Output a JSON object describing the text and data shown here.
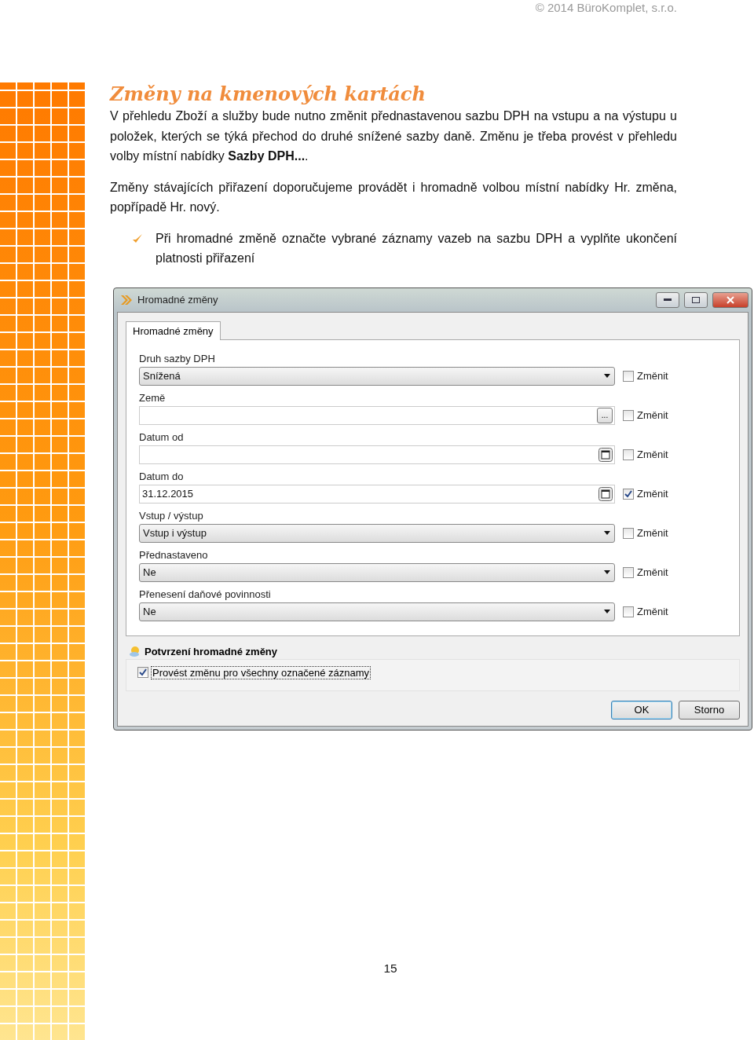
{
  "header": {
    "copyright": "© 2014 BüroKomplet, s.r.o."
  },
  "heading": "Změny na kmenových kartách",
  "paragraphs": [
    "V přehledu Zboží a služby bude nutno změnit přednastavenou sazbu DPH na vstupu a na výstupu u položek, kterých se týká přechod do druhé snížené sazby daně. Změnu je třeba provést v přehledu volby místní nabídky **Sazby DPH...**.",
    "Změny stávajících přiřazení doporučujeme provádět i hromadně volbou místní nabídky Hr. změna, popřípadě Hr. nový."
  ],
  "bullet": "Při hromadné změně označte vybrané záznamy vazeb na sazbu DPH a vyplňte ukončení platnosti přiřazení",
  "dialog": {
    "title": "Hromadné změny",
    "tabs": [
      {
        "label": "Hromadné změny",
        "selected": true
      }
    ],
    "fields": [
      {
        "label": "Druh sazby DPH",
        "kind": "select",
        "value": "Snížená",
        "checkbox_label": "Změnit",
        "checked": false
      },
      {
        "label": "Země",
        "kind": "lookup",
        "button": "...",
        "checkbox_label": "Změnit",
        "checked": false
      },
      {
        "label": "Datum od",
        "kind": "date",
        "checkbox_label": "Změnit",
        "checked": false
      },
      {
        "label": "Datum do",
        "kind": "date",
        "value": "31.12.2015",
        "checkbox_label": "Změnit",
        "checked": true
      },
      {
        "label": "Vstup / výstup",
        "kind": "select",
        "value": "Vstup i výstup",
        "checkbox_label": "Změnit",
        "checked": false
      },
      {
        "label": "Přednastaveno",
        "kind": "select",
        "value": "Ne",
        "checkbox_label": "Změnit",
        "checked": false
      },
      {
        "label": "Přenesení daňové povinnosti",
        "kind": "select",
        "value": "Ne",
        "checkbox_label": "Změnit",
        "checked": false
      }
    ],
    "confirm": {
      "title": "Potvrzení hromadné změny",
      "checkbox_label": "Provést změnu pro všechny označené záznamy",
      "checked": true
    },
    "buttons": [
      {
        "label": "OK",
        "default": true
      },
      {
        "label": "Storno",
        "default": false
      }
    ]
  },
  "page_number": "15"
}
